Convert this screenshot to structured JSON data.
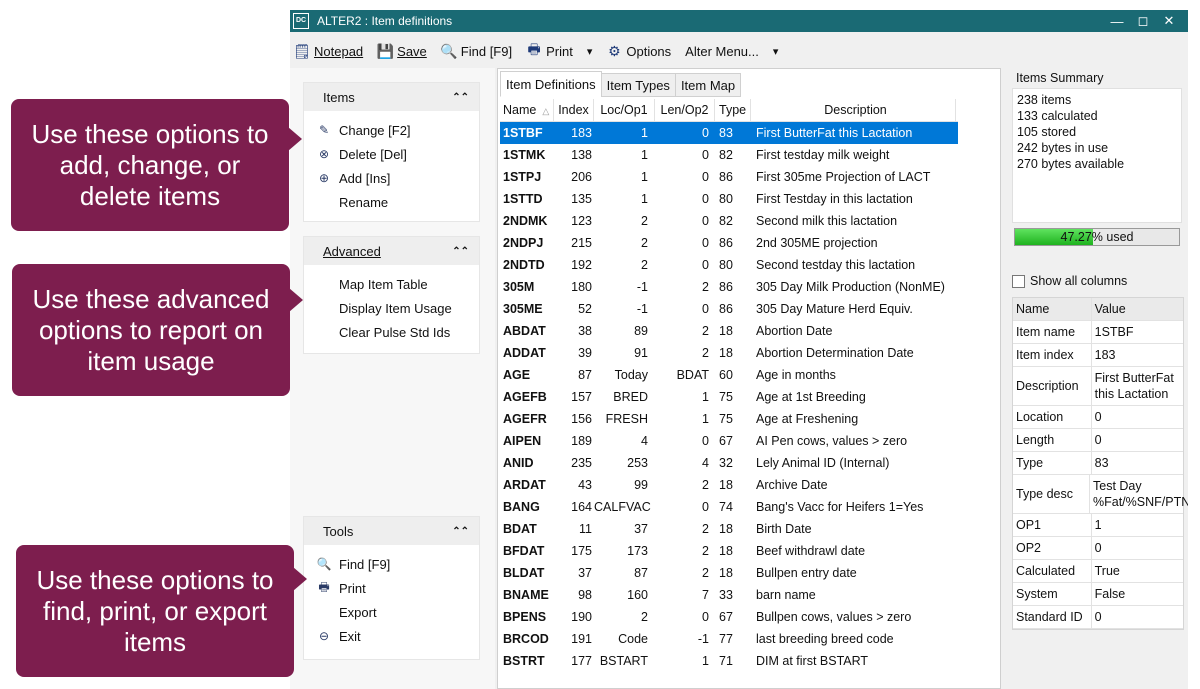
{
  "window": {
    "app_icon_text": "DC",
    "title": "ALTER2 : Item definitions"
  },
  "toolbar": [
    {
      "name": "notepad",
      "label": "Notepad",
      "icon": "notepad-icon",
      "glyph": "🗒"
    },
    {
      "name": "save",
      "label": "Save",
      "icon": "save-icon",
      "glyph": "💾"
    },
    {
      "name": "find",
      "label": "Find [F9]",
      "icon": "search-icon",
      "glyph": "🔍"
    },
    {
      "name": "print",
      "label": "Print",
      "icon": "printer-icon",
      "glyph": "🖶"
    },
    {
      "name": "options",
      "label": "Options",
      "icon": "gear-icon",
      "glyph": "⚙"
    },
    {
      "name": "alter-menu",
      "label": "Alter Menu...",
      "icon": "",
      "glyph": ""
    }
  ],
  "items_group": {
    "title": "Items",
    "items": [
      {
        "label": "Change [F2]",
        "icon": "edit-icon",
        "glyph": "✎"
      },
      {
        "label": "Delete [Del]",
        "icon": "delete-icon",
        "glyph": "⊗"
      },
      {
        "label": "Add [Ins]",
        "icon": "add-icon",
        "glyph": "⊕"
      },
      {
        "label": "Rename",
        "icon": "",
        "glyph": ""
      }
    ]
  },
  "advanced_group": {
    "title": "Advanced",
    "items": [
      {
        "label": "Map Item Table"
      },
      {
        "label": "Display Item Usage"
      },
      {
        "label": "Clear Pulse Std Ids"
      }
    ]
  },
  "tools_group": {
    "title": "Tools",
    "items": [
      {
        "label": "Find [F9]",
        "icon": "search-icon",
        "glyph": "🔍"
      },
      {
        "label": "Print",
        "icon": "printer-icon",
        "glyph": "🖶"
      },
      {
        "label": "Export",
        "icon": "",
        "glyph": ""
      },
      {
        "label": "Exit",
        "icon": "exit-icon",
        "glyph": "⊖"
      }
    ]
  },
  "tabs": [
    "Item Definitions",
    "Item Types",
    "Item Map"
  ],
  "grid": {
    "columns": [
      "Name",
      "Index",
      "Loc/Op1",
      "Len/Op2",
      "Type",
      "Description"
    ],
    "sort_indicator": "△",
    "selected_index": 0,
    "rows": [
      [
        "1STBF",
        "183",
        "1",
        "0",
        "83",
        "First ButterFat this Lactation"
      ],
      [
        "1STMK",
        "138",
        "1",
        "0",
        "82",
        "First testday milk weight"
      ],
      [
        "1STPJ",
        "206",
        "1",
        "0",
        "86",
        "First 305me Projection of LACT"
      ],
      [
        "1STTD",
        "135",
        "1",
        "0",
        "80",
        "First Testday in this lactation"
      ],
      [
        "2NDMK",
        "123",
        "2",
        "0",
        "82",
        "Second milk this lactation"
      ],
      [
        "2NDPJ",
        "215",
        "2",
        "0",
        "86",
        "2nd 305ME projection"
      ],
      [
        "2NDTD",
        "192",
        "2",
        "0",
        "80",
        "Second testday this lactation"
      ],
      [
        "305M",
        "180",
        "-1",
        "2",
        "86",
        "305 Day Milk Production (NonME)"
      ],
      [
        "305ME",
        "52",
        "-1",
        "0",
        "86",
        "305 Day Mature Herd Equiv."
      ],
      [
        "ABDAT",
        "38",
        "89",
        "2",
        "18",
        "Abortion Date"
      ],
      [
        "ADDAT",
        "39",
        "91",
        "2",
        "18",
        "Abortion Determination Date"
      ],
      [
        "AGE",
        "87",
        "Today",
        "BDAT",
        "60",
        "Age in months"
      ],
      [
        "AGEFB",
        "157",
        "BRED",
        "1",
        "75",
        "Age at 1st Breeding"
      ],
      [
        "AGEFR",
        "156",
        "FRESH",
        "1",
        "75",
        "Age at Freshening"
      ],
      [
        "AIPEN",
        "189",
        "4",
        "0",
        "67",
        "AI Pen cows, values > zero"
      ],
      [
        "ANID",
        "235",
        "253",
        "4",
        "32",
        "Lely Animal ID (Internal)"
      ],
      [
        "ARDAT",
        "43",
        "99",
        "2",
        "18",
        "Archive Date"
      ],
      [
        "BANG",
        "164",
        "CALFVAC",
        "0",
        "74",
        "Bang's Vacc for Heifers 1=Yes"
      ],
      [
        "BDAT",
        "11",
        "37",
        "2",
        "18",
        "Birth Date"
      ],
      [
        "BFDAT",
        "175",
        "173",
        "2",
        "18",
        "Beef withdrawl date"
      ],
      [
        "BLDAT",
        "37",
        "87",
        "2",
        "18",
        "Bullpen entry date"
      ],
      [
        "BNAME",
        "98",
        "160",
        "7",
        "33",
        "barn name"
      ],
      [
        "BPENS",
        "190",
        "2",
        "0",
        "67",
        "Bullpen cows, values > zero"
      ],
      [
        "BRCOD",
        "191",
        "Code",
        "-1",
        "77",
        "last breeding breed code"
      ],
      [
        "BSTRT",
        "177",
        "BSTART",
        "1",
        "71",
        "DIM at first BSTART"
      ]
    ]
  },
  "summary": {
    "title": "Items Summary",
    "lines": [
      "238 items",
      "133 calculated",
      "105 stored",
      "242 bytes in use",
      "270 bytes available"
    ],
    "usage_fraction": 0.4727,
    "usage_label": "47.27% used"
  },
  "show_all_columns": {
    "label": "Show all columns",
    "checked": false
  },
  "properties": {
    "header": [
      "Name",
      "Value"
    ],
    "rows": [
      [
        "Item name",
        "1STBF"
      ],
      [
        "Item index",
        "183"
      ],
      [
        "Description",
        "First ButterFat this Lactation"
      ],
      [
        "Location",
        "0"
      ],
      [
        "Length",
        "0"
      ],
      [
        "Type",
        "83"
      ],
      [
        "Type desc",
        "Test Day %Fat/%SNF/PTN"
      ],
      [
        "OP1",
        "1"
      ],
      [
        "OP2",
        "0"
      ],
      [
        "Calculated",
        "True"
      ],
      [
        "System",
        "False"
      ],
      [
        "Standard ID",
        "0"
      ]
    ]
  },
  "callouts": [
    "Use these options to add, change, or delete items",
    "Use these advanced options to report on item usage",
    "Use these options to find, print, or export items"
  ],
  "colors": {
    "titlebar": "#1a6a74",
    "callout": "#7d1e4e",
    "selection": "#0078d7",
    "progress": "#2fc42f"
  }
}
